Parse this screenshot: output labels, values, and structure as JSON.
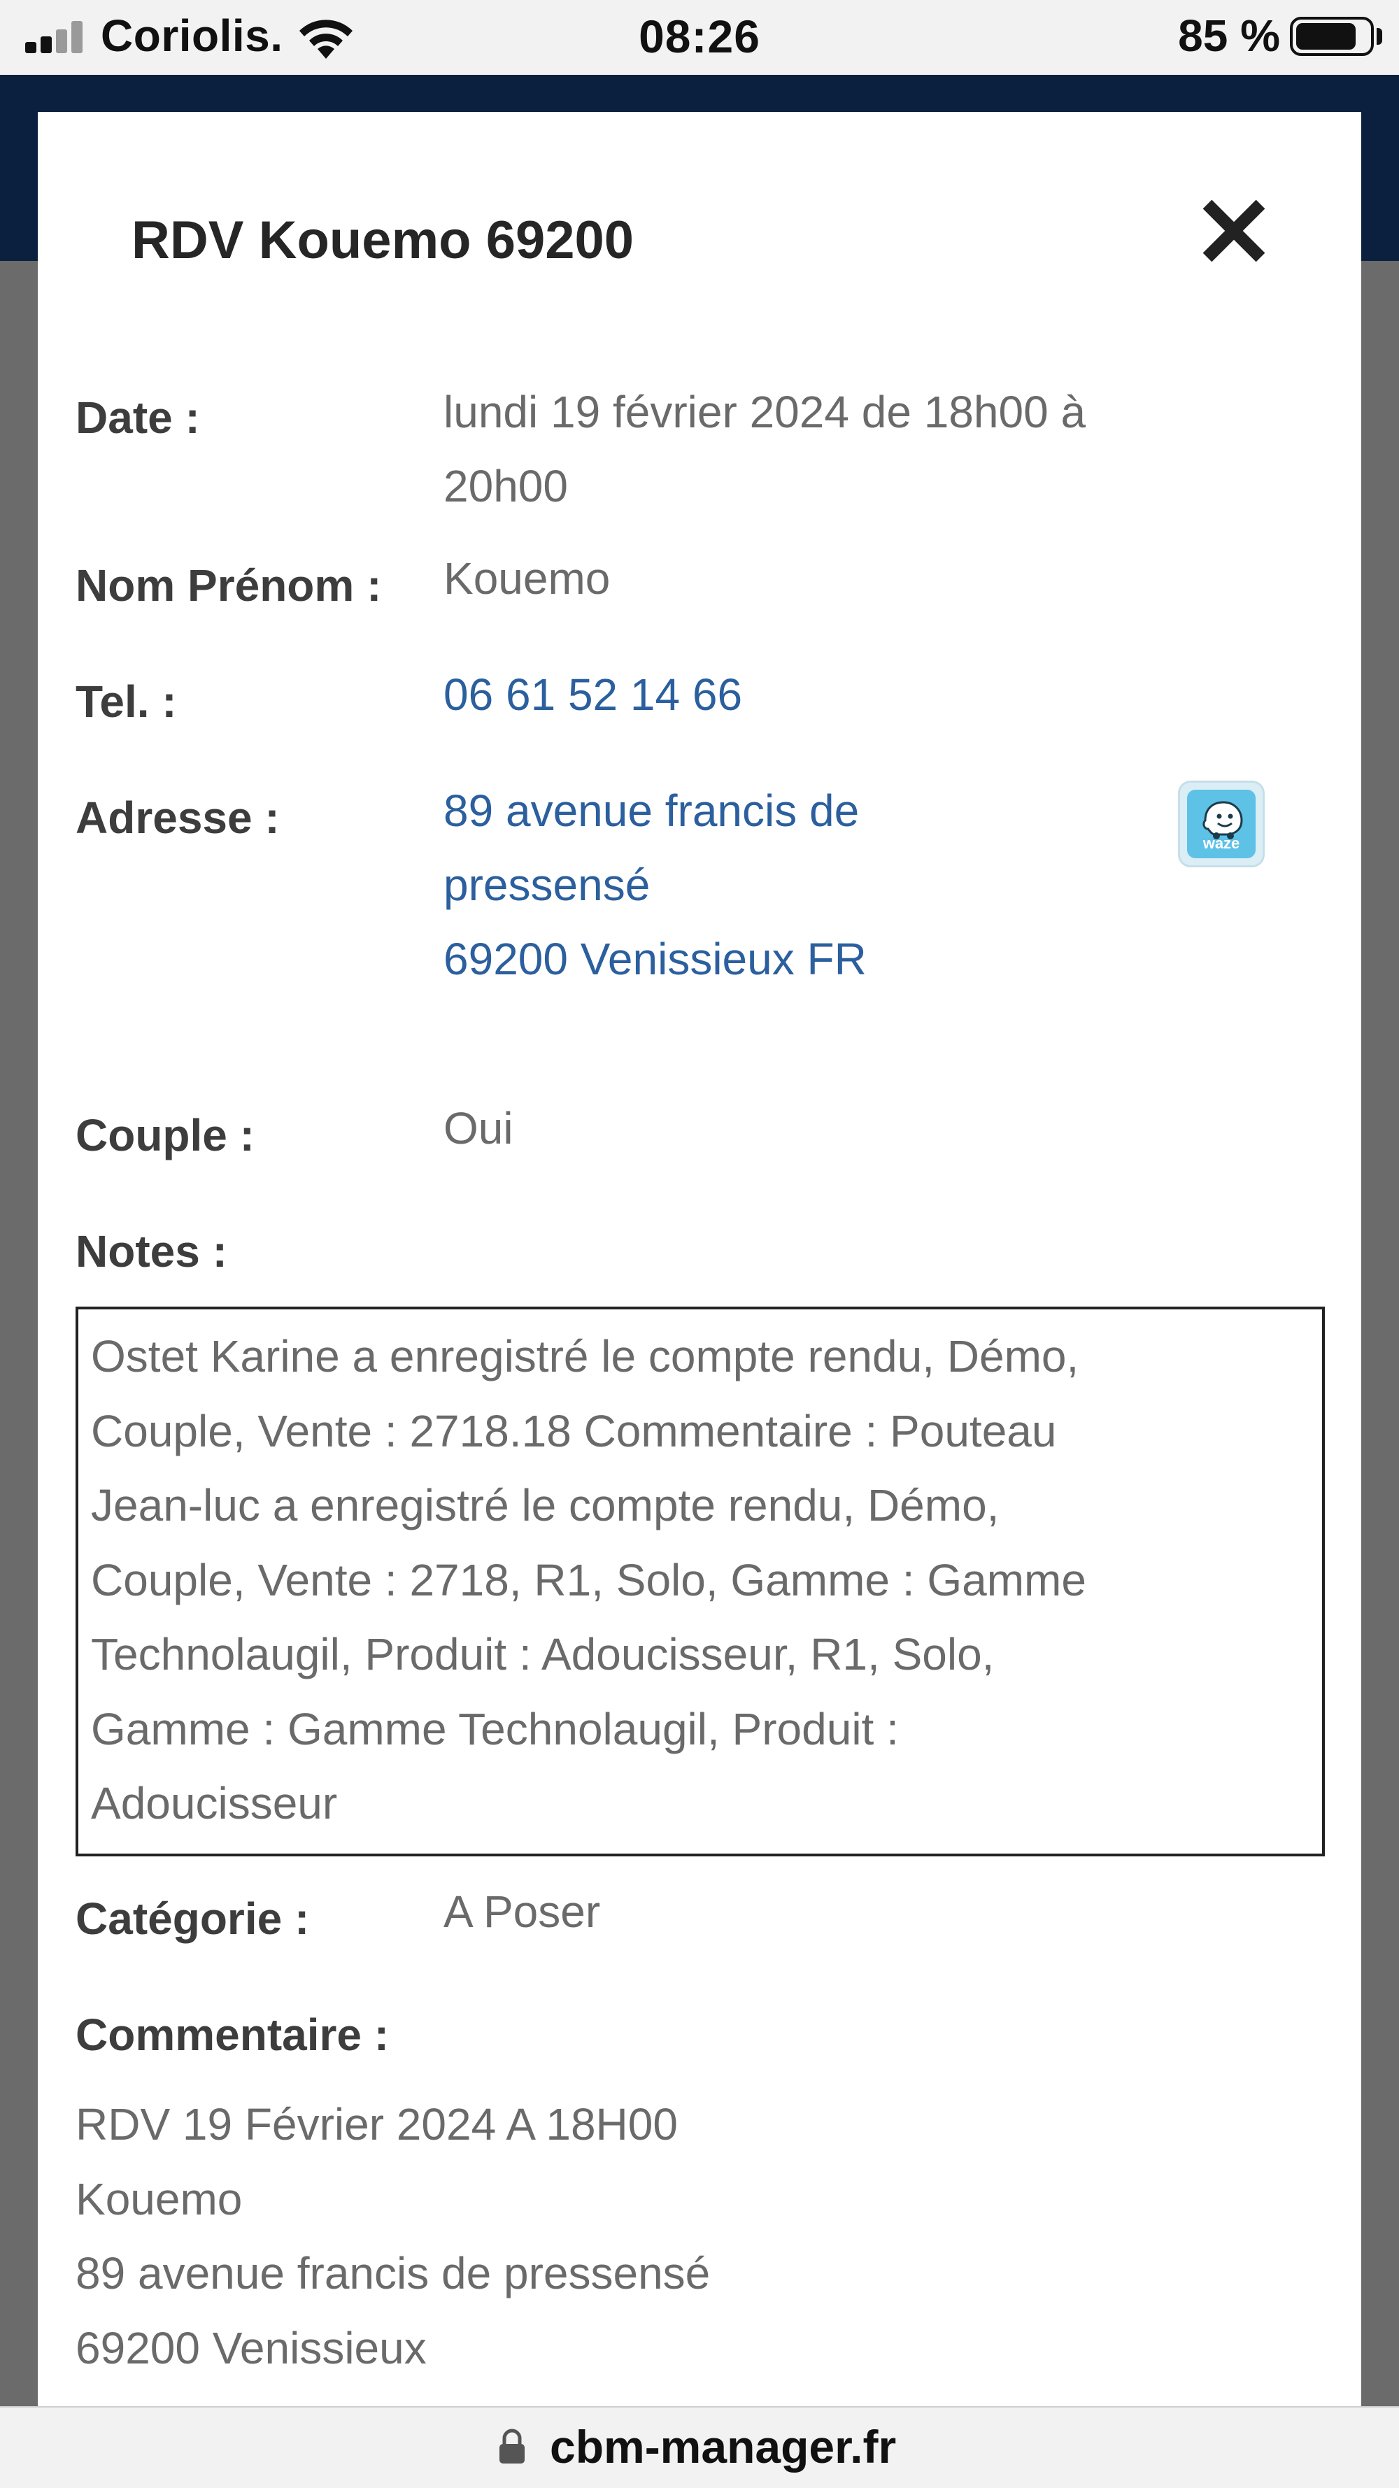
{
  "status_bar": {
    "carrier": "Coriolis.",
    "time": "08:26",
    "battery_percent": "85 %",
    "battery_level": 0.85,
    "signal_bars": 2
  },
  "modal": {
    "title": "RDV Kouemo 69200",
    "fields": {
      "date": {
        "label": "Date :",
        "lines": [
          "lundi 19 février 2024 de 18h00 à",
          "20h00"
        ]
      },
      "name": {
        "label": "Nom Prénom :",
        "value": "Kouemo"
      },
      "tel": {
        "label": "Tel. :",
        "value": "06 61 52 14 66"
      },
      "address": {
        "label": "Adresse :",
        "lines": [
          "89 avenue francis de",
          "pressensé",
          "69200 Venissieux FR"
        ]
      },
      "couple": {
        "label": "Couple :",
        "value": "Oui"
      },
      "notes": {
        "label": "Notes :",
        "lines": [
          "Ostet Karine a enregistré le compte rendu, Démo,",
          "Couple, Vente : 2718.18 Commentaire : Pouteau",
          "Jean-luc a enregistré le compte rendu, Démo,",
          "Couple, Vente : 2718, R1, Solo, Gamme : Gamme",
          "Technolaugil, Produit : Adoucisseur, R1, Solo,",
          "Gamme : Gamme Technolaugil, Produit :",
          "Adoucisseur"
        ]
      },
      "category": {
        "label": "Catégorie :",
        "value": "A Poser"
      },
      "comment": {
        "label": "Commentaire :",
        "lines": [
          "RDV 19 Février 2024 A 18H00",
          "Kouemo",
          "89 avenue francis de pressensé",
          "69200 Venissieux"
        ]
      }
    },
    "waze_label": "waze"
  },
  "url_bar": {
    "domain": "cbm-manager.fr"
  },
  "icons": {
    "close": "close-icon",
    "waze": "waze-icon",
    "lock": "lock-icon",
    "wifi": "wifi-icon",
    "battery": "battery-icon",
    "signal": "signal-icon"
  },
  "colors": {
    "link": "#2b5f9e",
    "header_bg": "#0b1f3e",
    "overlay": "#6b6b6b",
    "waze": "#5ec1e6"
  }
}
